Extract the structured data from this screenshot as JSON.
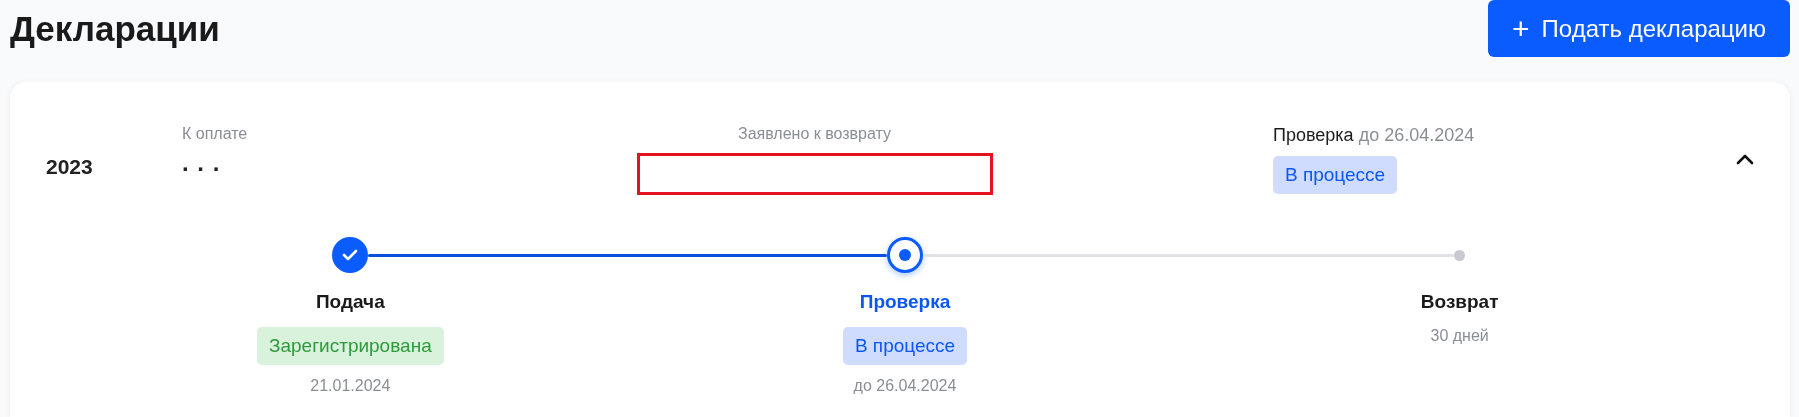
{
  "page": {
    "title": "Декларации"
  },
  "add_button": {
    "icon": "+",
    "label": "Подать декларацию"
  },
  "declarations": [
    {
      "year": "2023",
      "expanded": true,
      "to_pay": {
        "label": "К оплате",
        "value": ". . ."
      },
      "refund": {
        "label": "Заявлено к возврату",
        "redacted": true
      },
      "check": {
        "title": "Проверка",
        "deadline": "до 26.04.2024",
        "badge": {
          "text": "В процессе",
          "kind": "progress"
        }
      },
      "steps": [
        {
          "title": "Подача",
          "kind": "done",
          "badge": {
            "text": "Зарегистрирована",
            "kind": "success"
          },
          "note": "21.01.2024"
        },
        {
          "title": "Проверка",
          "kind": "current",
          "badge": {
            "text": "В процессе",
            "kind": "progress"
          },
          "note": "до 26.04.2024"
        },
        {
          "title": "Возврат",
          "kind": "pending",
          "note": "30 дней"
        }
      ]
    }
  ]
}
